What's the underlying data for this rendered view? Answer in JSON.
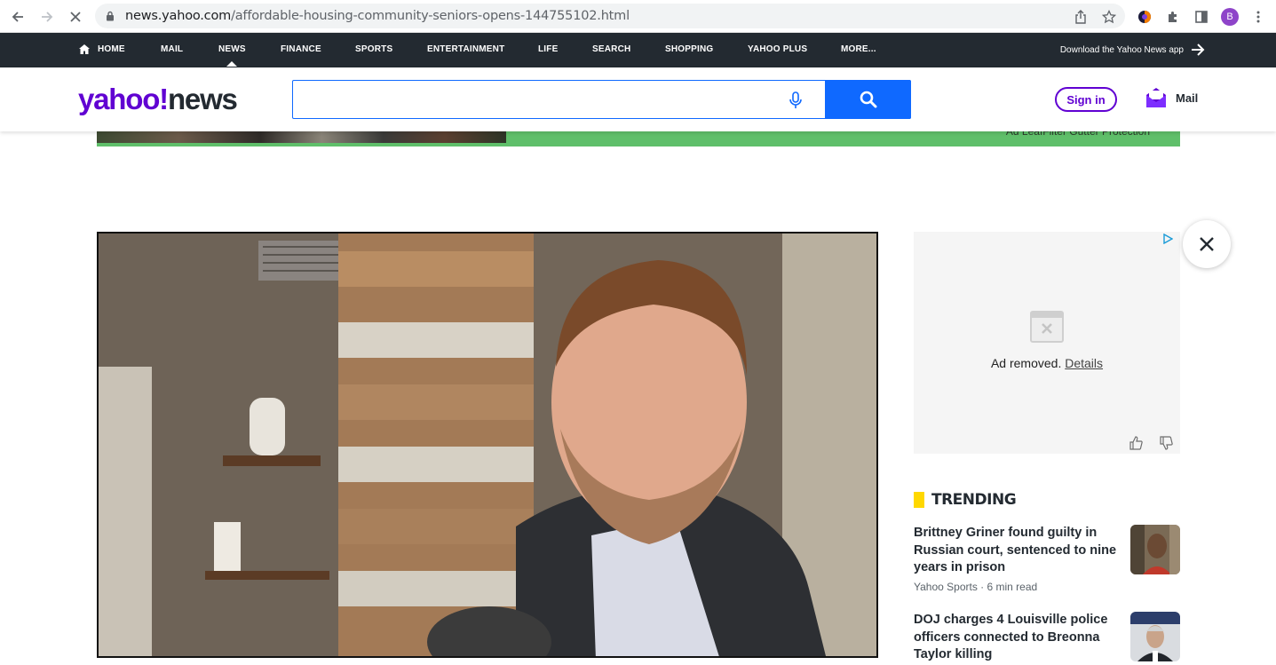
{
  "browser": {
    "url_domain": "news.yahoo.com",
    "url_path": "/affordable-housing-community-seniors-opens-144755102.html",
    "profile_initial": "B"
  },
  "topnav": {
    "items": [
      {
        "label": "HOME"
      },
      {
        "label": "MAIL"
      },
      {
        "label": "NEWS"
      },
      {
        "label": "FINANCE"
      },
      {
        "label": "SPORTS"
      },
      {
        "label": "ENTERTAINMENT"
      },
      {
        "label": "LIFE"
      },
      {
        "label": "SEARCH"
      },
      {
        "label": "SHOPPING"
      },
      {
        "label": "YAHOO PLUS"
      },
      {
        "label": "MORE..."
      }
    ],
    "active": "NEWS",
    "app_cta": "Download the Yahoo News app"
  },
  "header": {
    "logo_yahoo": "yahoo!",
    "logo_news": "news",
    "search_placeholder": "",
    "signin_label": "Sign in",
    "mail_label": "Mail"
  },
  "ad_strip": {
    "text": "Ad  LeafFilter Gutter Protection"
  },
  "sidebar_ad": {
    "removed_text": "Ad removed.",
    "details_link": "Details"
  },
  "trending": {
    "heading": "TRENDING",
    "items": [
      {
        "title": "Brittney Griner found guilty in Russian court, sentenced to nine years in prison",
        "meta": "Yahoo Sports · 6 min read"
      },
      {
        "title": "DOJ charges 4 Louisville police officers connected to Breonna Taylor killing",
        "meta": ""
      }
    ]
  },
  "colors": {
    "yahoo_purple": "#6001d2",
    "nav_bg": "#232a31",
    "search_blue": "#0f69ff",
    "trending_yellow": "#ffd800"
  }
}
